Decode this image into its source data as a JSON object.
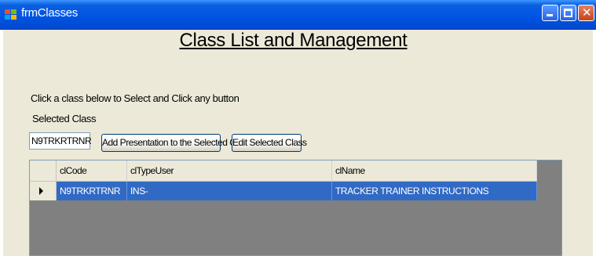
{
  "window": {
    "title": "frmClasses",
    "icon": "form-icon",
    "buttons": {
      "minimize": "minimize-icon",
      "maximize": "maximize-icon",
      "close": "close-icon"
    }
  },
  "form": {
    "heading": "Class List and Management",
    "instruction": "Click a class below to Select and Click any button",
    "selected_label": "Selected Class",
    "selected_value": "N9TRKRTRNR",
    "add_button": "Add Presentation to the Selected Class",
    "edit_button": "Edit Selected Class"
  },
  "grid": {
    "columns": [
      "clCode",
      "clTypeUser",
      "clName"
    ],
    "rows": [
      {
        "clCode": "N9TRKRTRNR",
        "clTypeUser": "INS-",
        "clName": "TRACKER TRAINER INSTRUCTIONS",
        "selected": true
      }
    ]
  },
  "colors": {
    "titlebar": "#0055e5",
    "client_bg": "#ece9d8",
    "selection": "#316ac5",
    "grid_bg": "#808080"
  }
}
